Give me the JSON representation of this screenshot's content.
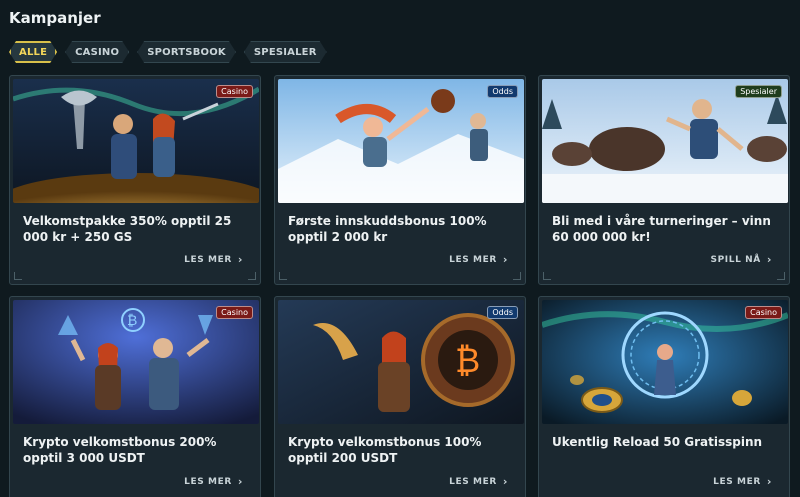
{
  "page": {
    "title": "Kampanjer"
  },
  "filters": [
    {
      "label": "ALLE",
      "active": true
    },
    {
      "label": "CASINO",
      "active": false
    },
    {
      "label": "SPORTSBOOK",
      "active": false
    },
    {
      "label": "SPESIALER",
      "active": false
    }
  ],
  "promos": [
    {
      "badge": "Casino",
      "headline": "Velkomstpakke 350% opptil 25 000 kr + 250 GS",
      "cta": "LES MER",
      "art": "viking-gold-hoard"
    },
    {
      "badge": "Odds",
      "headline": "Første innskuddsbonus 100% opptil 2 000 kr",
      "cta": "LES MER",
      "art": "viking-ball-snow"
    },
    {
      "badge": "Spesialer",
      "headline": "Bli med i våre turneringer – vinn 60 000 000 kr!",
      "cta": "SPILL NÅ",
      "art": "viking-boar-chase"
    },
    {
      "badge": "Casino",
      "headline": "Krypto velkomstbonus 200% opptil 3 000 USDT",
      "cta": "LES MER",
      "art": "viking-crypto-storm"
    },
    {
      "badge": "Odds",
      "headline": "Krypto velkomstbonus 100% opptil 200 USDT",
      "cta": "LES MER",
      "art": "viking-bitcoin-shield"
    },
    {
      "badge": "Casino",
      "headline": "Ukentlig Reload 50 Gratisspinn",
      "cta": "LES MER",
      "art": "reload-rune-circle"
    }
  ]
}
